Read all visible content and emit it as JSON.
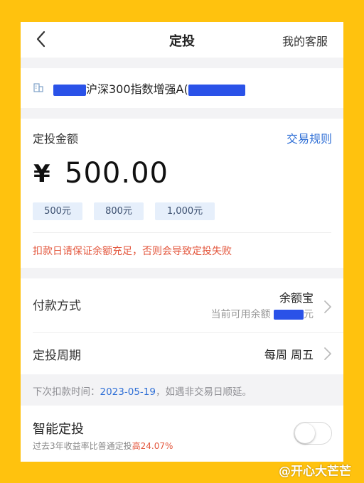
{
  "header": {
    "title": "定投",
    "service_label": "我的客服"
  },
  "fund": {
    "name_visible": "沪深300指数增强A("
  },
  "amount": {
    "label": "定投金额",
    "rules_link": "交易规则",
    "currency_symbol": "¥",
    "value": "500.00",
    "chips": [
      "500元",
      "800元",
      "1,000元"
    ],
    "warning": "扣款日请保证余额充足，否则会导致定投失败"
  },
  "payment": {
    "label": "付款方式",
    "method": "余额宝",
    "balance_prefix": "当前可用余额",
    "balance_suffix": "元"
  },
  "cycle": {
    "label": "定投周期",
    "value": "每周 周五"
  },
  "next_debit": {
    "prefix": "下次扣款时间：",
    "date": "2023-05-19",
    "suffix": "，如遇非交易日顺延。"
  },
  "smart": {
    "label": "智能定投",
    "sub_prefix": "过去3年收益率比普通定投",
    "sub_rate": "高24.07%",
    "toggle_on": false
  },
  "watermark": "@开心大芒芒",
  "colors": {
    "background": "#FFC20E",
    "link": "#2F6FD6",
    "warning": "#E3563C",
    "chip_bg": "#E6EFFB",
    "redaction": "#2A52E8"
  },
  "icons": {
    "back": "chevron-left-icon",
    "fund": "building-icon",
    "row_arrow": "chevron-right-icon"
  }
}
